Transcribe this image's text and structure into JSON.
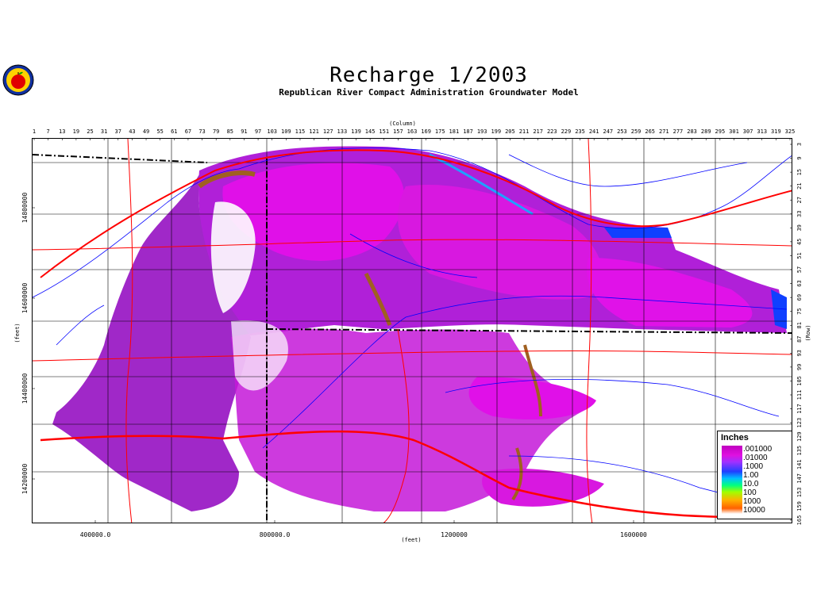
{
  "title": "Recharge  1/2003",
  "subtitle": "Republican River Compact Administration Groundwater Model",
  "axes": {
    "column_label": "(Column)",
    "row_label": "(Row)",
    "x_label": "(feet)",
    "y_label": "(feet)",
    "column_ticks": [
      "1",
      "7",
      "13",
      "19",
      "25",
      "31",
      "37",
      "43",
      "49",
      "55",
      "61",
      "67",
      "73",
      "79",
      "85",
      "91",
      "97",
      "103",
      "109",
      "115",
      "121",
      "127",
      "133",
      "139",
      "145",
      "151",
      "157",
      "163",
      "169",
      "175",
      "181",
      "187",
      "193",
      "199",
      "205",
      "211",
      "217",
      "223",
      "229",
      "235",
      "241",
      "247",
      "253",
      "259",
      "265",
      "271",
      "277",
      "283",
      "289",
      "295",
      "301",
      "307",
      "313",
      "319",
      "325"
    ],
    "row_ticks": [
      "3",
      "9",
      "15",
      "21",
      "27",
      "33",
      "39",
      "45",
      "51",
      "57",
      "63",
      "69",
      "75",
      "81",
      "87",
      "93",
      "99",
      "105",
      "111",
      "117",
      "123",
      "129",
      "135",
      "141",
      "147",
      "153",
      "159",
      "165"
    ],
    "x_ticks": [
      "400000.0",
      "800000.0",
      "1200000",
      "1600000"
    ],
    "y_ticks": [
      "14800000",
      "14600000",
      "14400000",
      "14200000"
    ]
  },
  "legend": {
    "title": "Inches",
    "labels": [
      ".001000",
      ".01000",
      ".1000",
      "1.00",
      "10.0",
      "100",
      "1000",
      "10000"
    ]
  },
  "colors": {
    "recharge_low": "#c000c0",
    "recharge_mid": "#e010e0",
    "recharge_high": "#9030d0",
    "edge": "#a06020",
    "rivers": "#0000ff",
    "roads": "#ff0000",
    "counties": "#000000"
  },
  "icons": {
    "logo": "apple-logo-icon"
  }
}
